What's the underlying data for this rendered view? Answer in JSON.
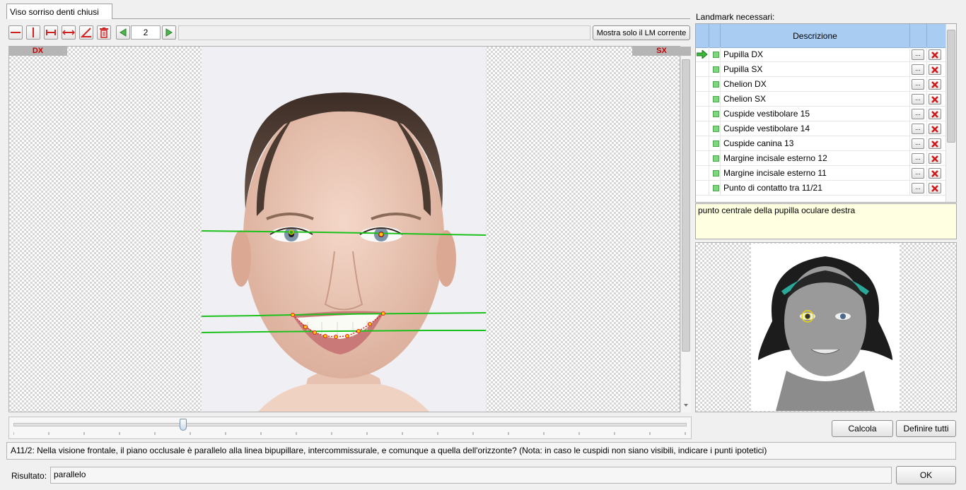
{
  "tab": {
    "label": "Viso sorriso denti chiusi"
  },
  "toolbar": {
    "tools": [
      {
        "name": "horizontal-line-tool",
        "icon": "horizontal-line-icon"
      },
      {
        "name": "vertical-line-tool",
        "icon": "vertical-line-icon"
      },
      {
        "name": "segment-tool",
        "icon": "segment-icon"
      },
      {
        "name": "measure-tool",
        "icon": "measure-arrows-icon"
      },
      {
        "name": "angle-tool",
        "icon": "angle-icon"
      },
      {
        "name": "delete-tool",
        "icon": "trash-icon"
      }
    ],
    "page_number": "2",
    "show_current_button": "Mostra solo il LM corrente"
  },
  "image_view": {
    "left_label": "DX",
    "right_label": "SX"
  },
  "landmarks": {
    "header": "Landmark necessari:",
    "column_title": "Descrizione",
    "items": [
      {
        "label": "Pupilla DX",
        "current": true
      },
      {
        "label": "Pupilla SX",
        "current": false
      },
      {
        "label": "Chelion DX",
        "current": false
      },
      {
        "label": "Chelion SX",
        "current": false
      },
      {
        "label": "Cuspide vestibolare 15",
        "current": false
      },
      {
        "label": "Cuspide vestibolare 14",
        "current": false
      },
      {
        "label": "Cuspide canina 13",
        "current": false
      },
      {
        "label": "Margine incisale esterno 12",
        "current": false
      },
      {
        "label": "Margine incisale esterno 11",
        "current": false
      },
      {
        "label": "Punto di contatto tra 11/21",
        "current": false
      }
    ],
    "edit_label": "...",
    "description": "punto centrale della pupilla oculare destra"
  },
  "slider": {
    "value": 0.25
  },
  "buttons": {
    "calcola": "Calcola",
    "definire": "Definire tutti",
    "ok": "OK"
  },
  "question": "A11/2: Nella visione frontale, il piano occlusale è parallelo alla linea bipupillare, intercommissurale, e comunque a quella dell'orizzonte? (Nota: in caso le cuspidi non siano visibili, indicare i punti ipotetici)",
  "result": {
    "label": "Risultato:",
    "value": "parallelo"
  },
  "colors": {
    "accent_header": "#a9cdf2",
    "guide_line": "#1cc21c",
    "landmark_point": "#e02020",
    "note_bg": "#ffffe1"
  }
}
